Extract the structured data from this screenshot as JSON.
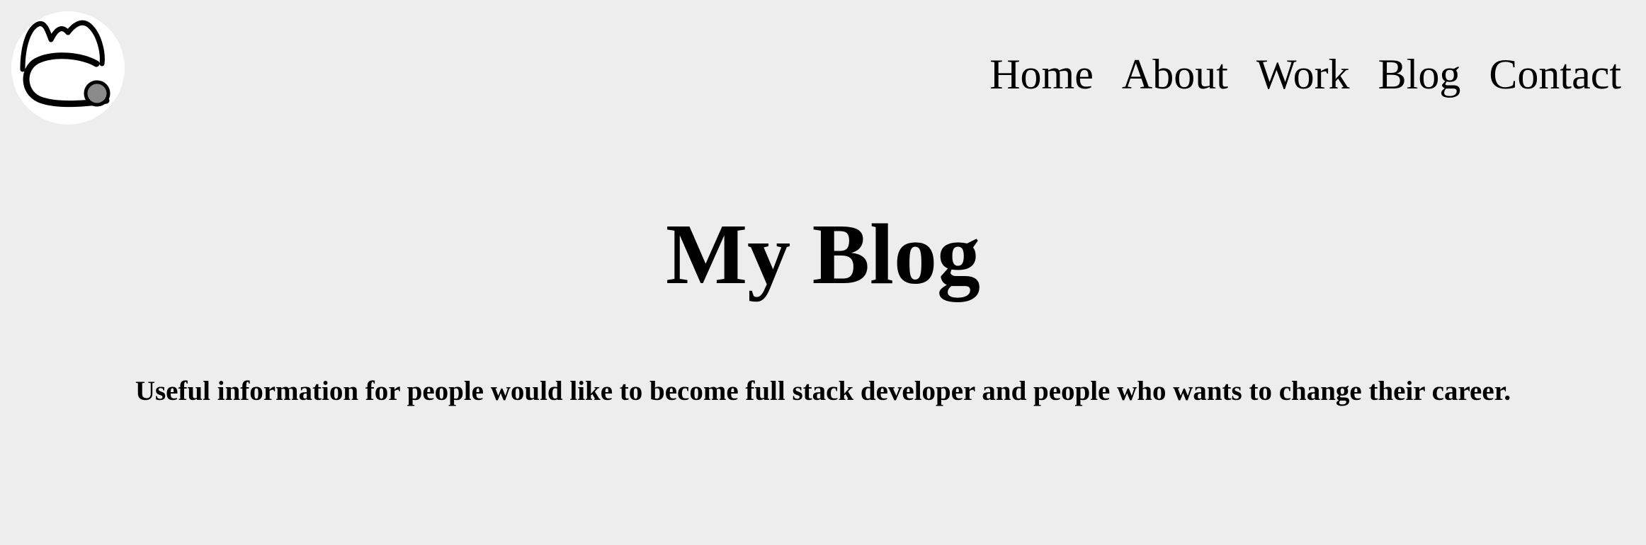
{
  "header": {
    "logo_icon": "mc-monogram-logo-icon",
    "nav": [
      {
        "label": "Home"
      },
      {
        "label": "About"
      },
      {
        "label": "Work"
      },
      {
        "label": "Blog"
      },
      {
        "label": "Contact"
      }
    ]
  },
  "main": {
    "title": "My Blog",
    "subtitle": "Useful information for people would like to become full stack developer and people who wants to change their career."
  },
  "colors": {
    "background": "#ededed",
    "logo_background": "#ffffff",
    "text": "#000000",
    "logo_dot": "#8a8a8a"
  }
}
